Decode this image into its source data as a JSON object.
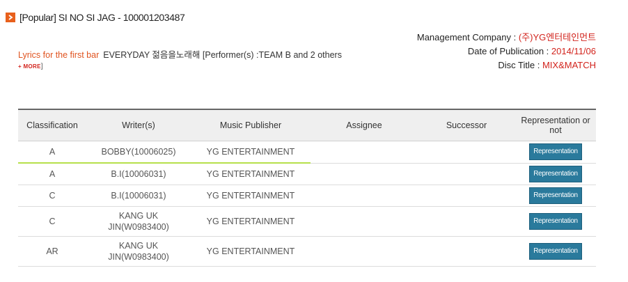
{
  "header": {
    "title": "[Popular] SI NO SI JAG - 100001203487"
  },
  "meta": {
    "management_label": "Management Company : ",
    "management_value": "(주)YG엔터테인먼트",
    "publication_label": "Date of Publication : ",
    "publication_value": "2014/11/06",
    "disc_label": "Disc Title : ",
    "disc_value": "MIX&MATCH"
  },
  "lyrics": {
    "label": "Lyrics for the first bar",
    "text": "EVERYDAY 젊음을노래해 [Performer(s) :TEAM B and 2 others",
    "more_prefix": "+",
    "more_label": "MORE",
    "more_suffix": "]"
  },
  "table": {
    "headers": {
      "classification": "Classification",
      "writer": "Writer(s)",
      "publisher": "Music Publisher",
      "assignee": "Assignee",
      "successor": "Successor",
      "representation": "Representation or not"
    },
    "rows": [
      {
        "classification": "A",
        "writer": "BOBBY(10006025)",
        "publisher": "YG ENTERTAINMENT",
        "assignee": "",
        "successor": "",
        "button": "Representation"
      },
      {
        "classification": "A",
        "writer": "B.I(10006031)",
        "publisher": "YG ENTERTAINMENT",
        "assignee": "",
        "successor": "",
        "button": "Representation"
      },
      {
        "classification": "C",
        "writer": "B.I(10006031)",
        "publisher": "YG ENTERTAINMENT",
        "assignee": "",
        "successor": "",
        "button": "Representation"
      },
      {
        "classification": "C",
        "writer": "KANG UK JIN(W0983400)",
        "publisher": "YG ENTERTAINMENT",
        "assignee": "",
        "successor": "",
        "button": "Representation"
      },
      {
        "classification": "AR",
        "writer": "KANG UK JIN(W0983400)",
        "publisher": "YG ENTERTAINMENT",
        "assignee": "",
        "successor": "",
        "button": "Representation"
      }
    ]
  },
  "colors": {
    "accent_orange": "#e8601c",
    "value_red": "#d2231c",
    "button_blue": "#2a7a9c",
    "highlight_green": "#b6e04a"
  }
}
